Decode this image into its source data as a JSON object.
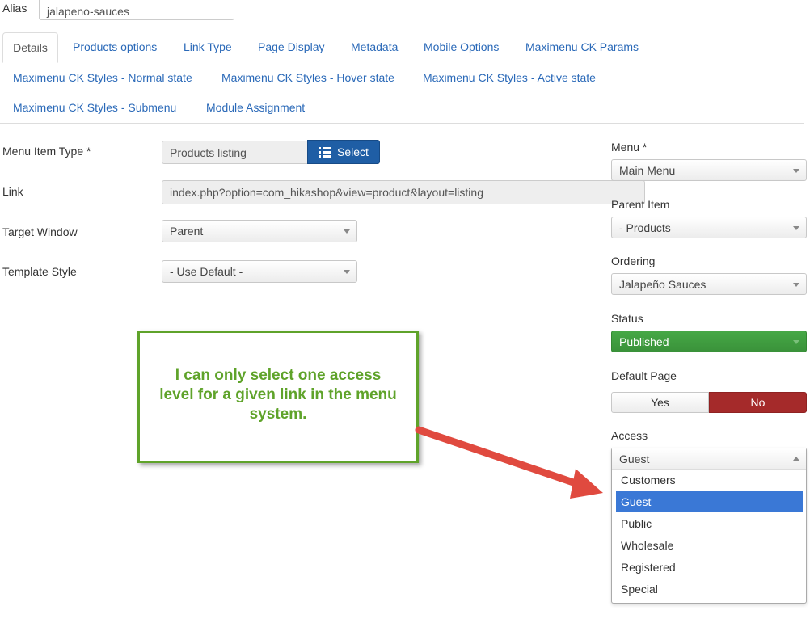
{
  "alias": {
    "label": "Alias",
    "value": "jalapeno-sauces"
  },
  "tabs": [
    {
      "label": "Details",
      "active": true
    },
    {
      "label": "Products options"
    },
    {
      "label": "Link Type"
    },
    {
      "label": "Page Display"
    },
    {
      "label": "Metadata"
    },
    {
      "label": "Mobile Options"
    },
    {
      "label": "Maximenu CK Params"
    },
    {
      "label": "Maximenu CK Styles - Normal state"
    },
    {
      "label": "Maximenu CK Styles - Hover state"
    },
    {
      "label": "Maximenu CK Styles - Active state"
    },
    {
      "label": "Maximenu CK Styles - Submenu"
    },
    {
      "label": "Module Assignment"
    }
  ],
  "details": {
    "menu_item_type": {
      "label": "Menu Item Type *",
      "value": "Products listing",
      "button": "Select",
      "button_icon": "list-icon"
    },
    "link": {
      "label": "Link",
      "value": "index.php?option=com_hikashop&view=product&layout=listing"
    },
    "target_window": {
      "label": "Target Window",
      "value": "Parent"
    },
    "template_style": {
      "label": "Template Style",
      "value": "- Use Default -"
    }
  },
  "sidebar": {
    "menu": {
      "label": "Menu *",
      "value": "Main Menu"
    },
    "parent_item": {
      "label": "Parent Item",
      "value": "- Products"
    },
    "ordering": {
      "label": "Ordering",
      "value": "Jalapeño Sauces"
    },
    "status": {
      "label": "Status",
      "value": "Published"
    },
    "default_page": {
      "label": "Default Page",
      "yes": "Yes",
      "no": "No",
      "selected": "No"
    },
    "access": {
      "label": "Access",
      "value": "Guest",
      "options": [
        "Customers",
        "Guest",
        "Public",
        "Wholesale",
        "Registered",
        "Special"
      ],
      "highlighted": "Guest"
    }
  },
  "annotation": {
    "text": "I can only select one access level for a given link  in the menu system."
  },
  "colors": {
    "link_blue": "#2a69b8",
    "select_button": "#1f5ea5",
    "published_green": "#3d9b3d",
    "no_red": "#a52a2a",
    "highlight_blue": "#3a78d6",
    "callout_green": "#5fa32a",
    "arrow_red": "#e04a3f"
  }
}
